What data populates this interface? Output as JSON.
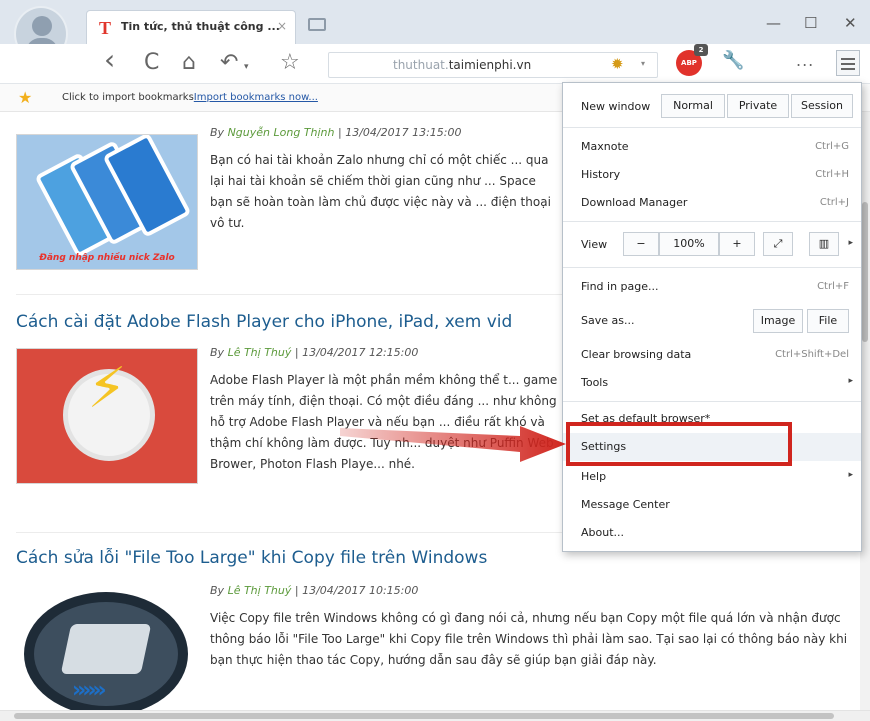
{
  "browser": {
    "tab_title": "Tin tức, thủ thuật công ...",
    "tab_favicon": "T",
    "tab_close": "×",
    "url_prefix": "thuthuat.",
    "url_domain": "taimienphi.vn",
    "back_icon": "‹",
    "refresh_icon": "C",
    "home_icon": "⌂",
    "undo_icon": "↶",
    "undo_caret": "▾",
    "bookmark_icon": "☆",
    "bug_icon": "✹",
    "url_chevron": "▾",
    "adblock_text": "ABP",
    "adblock_badge": "2",
    "wrench_icon": "🔧",
    "more_dots": "...",
    "minimize": "—",
    "maximize": "☐",
    "close": "✕"
  },
  "bookmark_bar": {
    "star_icon": "★",
    "prompt": "Click to import bookmarks",
    "link": "Import bookmarks now..."
  },
  "articles": [
    {
      "title": "",
      "author": "Nguyễn Long Thịnh",
      "date": "13/04/2017 13:15:00",
      "desc": "Bạn có hai tài khoản Zalo nhưng chỉ có một chiếc ... qua lại hai tài khoản sẽ chiếm thời gian cũng như ... Space bạn sẽ hoàn toàn làm chủ được việc này và ... điện thoại vô tư.",
      "thumb_caption": "Đăng nhập nhiều nick Zalo"
    },
    {
      "title": "Cách cài đặt Adobe Flash Player cho iPhone, iPad, xem vid",
      "author": "Lê Thị Thuý",
      "date": "13/04/2017 12:15:00",
      "desc": "Adobe Flash Player là một phần mềm không thể t... game trên máy tính, điện thoại. Có một điều đáng ... như không hỗ trợ Adobe Flash Player và nếu bạn ... điều rất khó và thậm chí không làm được. Tuy nh... duyệt như Puffin Web Brower, Photon Flash Playe... nhé.",
      "thumb_caption": ""
    },
    {
      "title": "Cách sửa lỗi \"File Too Large\" khi Copy file trên Windows",
      "author": "Lê Thị Thuý",
      "date": "13/04/2017 10:15:00",
      "desc": "Việc Copy file trên Windows không có gì đang nói cả, nhưng nếu bạn Copy một file quá lớn và nhận được thông báo lỗi \"File Too Large\" khi Copy file trên Windows thì phải làm sao. Tại sao lại có thông báo này khi bạn thực hiện thao tác Copy, hướng dẫn sau đây sẽ giúp bạn giải đáp này.",
      "thumb_caption": ""
    }
  ],
  "byline_prefix": "By",
  "menu": {
    "new_window": "New window",
    "normal": "Normal",
    "private": "Private",
    "session": "Session",
    "maxnote": "Maxnote",
    "maxnote_shortcut": "Ctrl+G",
    "history": "History",
    "history_shortcut": "Ctrl+H",
    "download_manager": "Download Manager",
    "download_shortcut": "Ctrl+J",
    "view": "View",
    "zoom_out": "−",
    "zoom_level": "100%",
    "zoom_in": "+",
    "fullscreen_icon": "⤢",
    "split_icon": "▥",
    "view_arrow": "▸",
    "find_in_page": "Find in page...",
    "find_shortcut": "Ctrl+F",
    "save_as": "Save as...",
    "image": "Image",
    "file": "File",
    "clear_browsing_data": "Clear browsing data",
    "clear_shortcut": "Ctrl+Shift+Del",
    "tools": "Tools",
    "set_default": "Set as default browser*",
    "settings": "Settings",
    "help": "Help",
    "message_center": "Message Center",
    "about": "About..."
  },
  "colors": {
    "highlight_box": "#d0251e",
    "arrow": "#d0251e",
    "link_title": "#1d5d8f",
    "author": "#5c9a3b"
  }
}
